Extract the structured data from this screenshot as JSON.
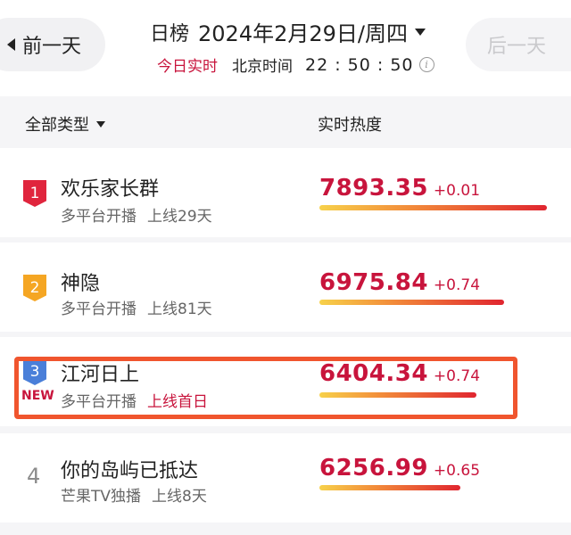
{
  "header": {
    "prev_label": "前一天",
    "next_label": "后一天",
    "title_label": "日榜",
    "title_date": "2024年2月29日/周四",
    "live_tag": "今日实时",
    "beijing_label": "北京时间",
    "clock": "22 : 50 : 50"
  },
  "columns": {
    "filter_label": "全部类型",
    "heat_label": "实时热度"
  },
  "colors": {
    "accent_red": "#c8143c",
    "highlight": "#f0552e",
    "rank1": "#e0253d",
    "rank2": "#f5a623",
    "rank3": "#4a7fd9"
  },
  "rows": [
    {
      "rank": "1",
      "name": "欢乐家长群",
      "platform": "多平台开播",
      "days": "上线29天",
      "days_red": false,
      "new_label": "",
      "heat": "7893.35",
      "delta": "+0.01",
      "bar_fraction": 1.0
    },
    {
      "rank": "2",
      "name": "神隐",
      "platform": "多平台开播",
      "days": "上线81天",
      "days_red": false,
      "new_label": "",
      "heat": "6975.84",
      "delta": "+0.74",
      "bar_fraction": 0.81
    },
    {
      "rank": "3",
      "name": "江河日上",
      "platform": "多平台开播",
      "days": "上线首日",
      "days_red": true,
      "new_label": "NEW",
      "heat": "6404.34",
      "delta": "+0.74",
      "bar_fraction": 0.69
    },
    {
      "rank": "4",
      "name": "你的岛屿已抵达",
      "platform": "芒果TV独播",
      "days": "上线8天",
      "days_red": false,
      "new_label": "",
      "heat": "6256.99",
      "delta": "+0.65",
      "bar_fraction": 0.62
    }
  ]
}
